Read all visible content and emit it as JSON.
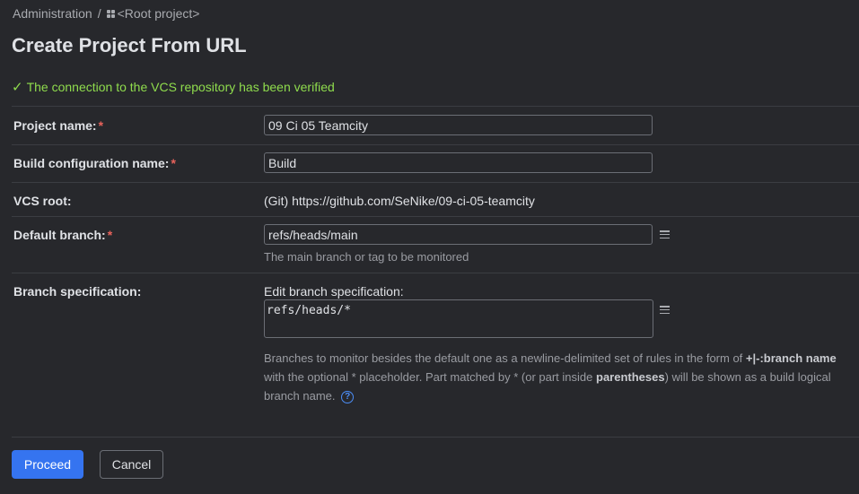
{
  "breadcrumb": {
    "root": "Administration",
    "separator": "/",
    "project": "<Root project>"
  },
  "page_title": "Create Project From URL",
  "status_message": "The connection to the VCS repository has been verified",
  "status_icon": "check-icon",
  "form": {
    "project_name": {
      "label": "Project name:",
      "required": "*",
      "value": "09 Ci 05 Teamcity"
    },
    "build_config_name": {
      "label": "Build configuration name:",
      "required": "*",
      "value": "Build"
    },
    "vcs_root": {
      "label": "VCS root:",
      "value": "(Git) https://github.com/SeNike/09-ci-05-teamcity"
    },
    "default_branch": {
      "label": "Default branch:",
      "required": "*",
      "value": "refs/heads/main",
      "hint": "The main branch or tag to be monitored"
    },
    "branch_spec": {
      "label": "Branch specification:",
      "edit_label": "Edit branch specification:",
      "value": "refs/heads/*",
      "desc_1": "Branches to monitor besides the default one as a newline-delimited set of rules in the form of ",
      "desc_rule": "+|-:branch name",
      "desc_2": " with the optional * placeholder. Part matched by * (or part inside ",
      "desc_parens": "parentheses",
      "desc_3": ") will be shown as a build logical branch name.",
      "help": "?"
    }
  },
  "buttons": {
    "proceed": "Proceed",
    "cancel": "Cancel"
  },
  "colors": {
    "accent": "#3574f0",
    "success": "#8fdc4d",
    "required": "#e8625b",
    "background": "#27282c"
  }
}
